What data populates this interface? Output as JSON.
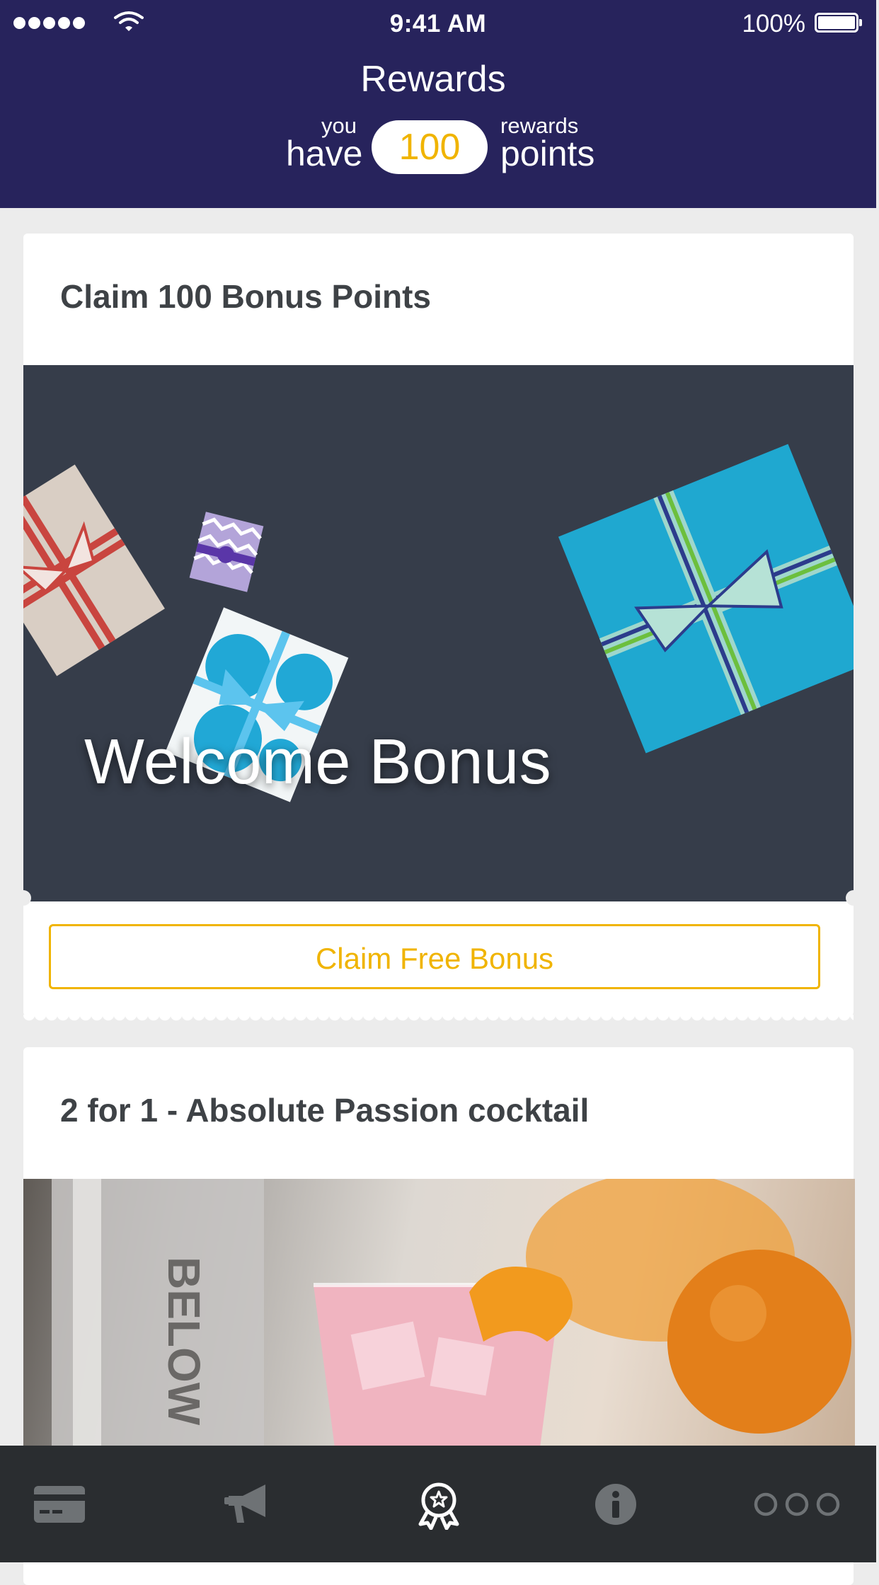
{
  "status_bar": {
    "time": "9:41 AM",
    "battery": "100%"
  },
  "header": {
    "title": "Rewards",
    "you": "you",
    "have": "have",
    "points": "100",
    "rewards": "rewards",
    "points_word": "points"
  },
  "cards": [
    {
      "title": "Claim 100 Bonus Points",
      "image_text": "Welcome Bonus",
      "button_label": "Claim Free Bonus"
    },
    {
      "title": "2 for 1 - Absolute Passion cocktail",
      "image_text": "BELOW"
    }
  ],
  "tabbar": {
    "items": [
      {
        "icon": "card-icon",
        "active": false
      },
      {
        "icon": "megaphone-icon",
        "active": false
      },
      {
        "icon": "rewards-badge-icon",
        "active": true
      },
      {
        "icon": "info-icon",
        "active": false
      },
      {
        "icon": "more-icon",
        "active": false
      }
    ]
  },
  "colors": {
    "header_bg": "#27235c",
    "accent": "#f0b400",
    "tabbar_bg": "#2a2d30",
    "tab_inactive": "#6e7275",
    "tab_active": "#ffffff"
  }
}
